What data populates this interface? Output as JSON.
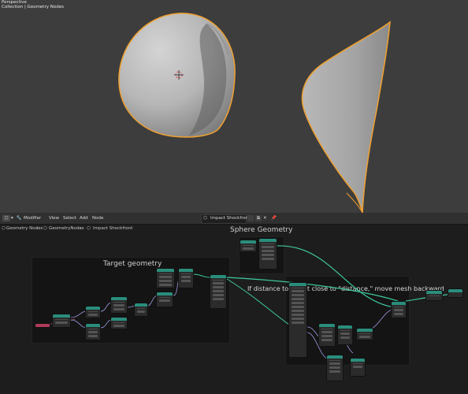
{
  "viewport": {
    "mode_label": "Perspective",
    "breadcrumb": "Collection | Geometry Nodes"
  },
  "node_header": {
    "editor_icon": "node-editor-icon",
    "menus": [
      "Modifier",
      "View",
      "Select",
      "Add",
      "Node"
    ],
    "tree_name": "Impact Shockfront"
  },
  "breadcrumb": [
    "Geometry Nodes",
    "GeometryNodes",
    "Impact Shockfront"
  ],
  "frames": {
    "target_label": "Target geometry",
    "sphere_label": "Sphere Geometry",
    "distance_note": "If distance to target close to \"distance,\" move mesh backward"
  },
  "colors": {
    "viewport_bg": "#3d3d3d",
    "selection_outline": "#f0a030",
    "wire": "#3ec9a0",
    "geometry_header": "#2a8d7c",
    "input_header": "#b03a5a"
  }
}
